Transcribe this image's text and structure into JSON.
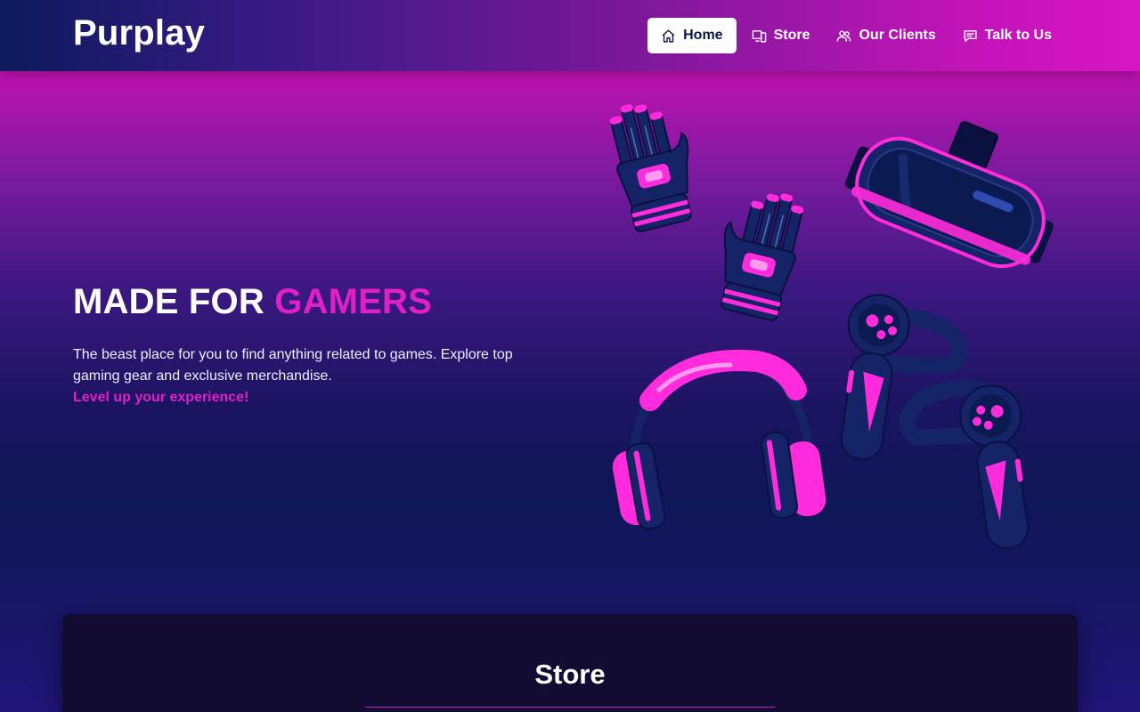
{
  "brand": "Purplay",
  "nav": {
    "items": [
      {
        "label": "Home",
        "icon": "home-icon",
        "active": true
      },
      {
        "label": "Store",
        "icon": "devices-icon",
        "active": false
      },
      {
        "label": "Our Clients",
        "icon": "users-icon",
        "active": false
      },
      {
        "label": "Talk to Us",
        "icon": "chat-icon",
        "active": false
      }
    ]
  },
  "hero": {
    "title_main": "MADE FOR",
    "title_accent": "GAMERS",
    "description": "The beast place for you to find anything related to games. Explore top gaming gear and exclusive merchandise.",
    "cta": "Level up your experience!",
    "illustration_items": [
      "vr-glove-left-icon",
      "vr-glove-right-icon",
      "vr-headset-icon",
      "headphones-icon",
      "vr-controller-left-icon",
      "vr-controller-right-icon"
    ]
  },
  "store": {
    "title": "Store"
  },
  "colors": {
    "accent": "#e01fc8",
    "navy": "#0d1545",
    "card": "#120c33",
    "pink": "#ff2bdc"
  }
}
